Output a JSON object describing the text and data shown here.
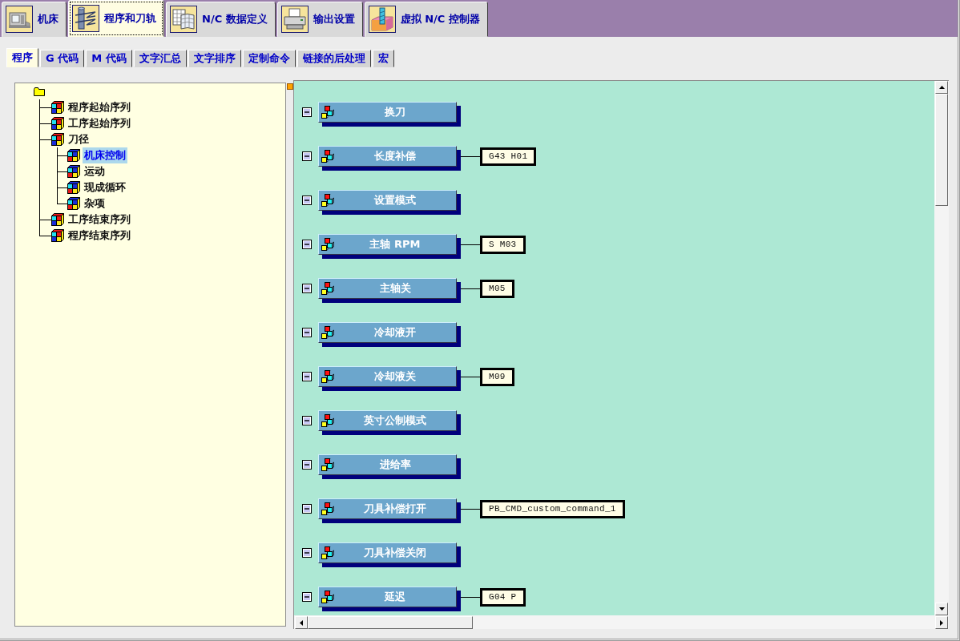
{
  "main_tabs": [
    {
      "label": "机床",
      "kind": "machine",
      "selected": false
    },
    {
      "label": "程序和刀轨",
      "kind": "program",
      "selected": true
    },
    {
      "label": "N/C 数据定义",
      "kind": "data",
      "selected": false
    },
    {
      "label": "输出设置",
      "kind": "output",
      "selected": false
    },
    {
      "label": "虚拟 N/C 控制器",
      "kind": "virtual",
      "selected": false
    }
  ],
  "sub_tabs": [
    {
      "label": "程序",
      "selected": true
    },
    {
      "label": "G 代码",
      "selected": false
    },
    {
      "label": "M 代码",
      "selected": false
    },
    {
      "label": "文字汇总",
      "selected": false
    },
    {
      "label": "文字排序",
      "selected": false
    },
    {
      "label": "定制命令",
      "selected": false
    },
    {
      "label": "链接的后处理",
      "selected": false
    },
    {
      "label": "宏",
      "selected": false
    }
  ],
  "tree": {
    "children": [
      {
        "label": "程序起始序列",
        "selected": false
      },
      {
        "label": "工序起始序列",
        "selected": false
      },
      {
        "label": "刀径",
        "selected": false,
        "children": [
          {
            "label": "机床控制",
            "selected": true
          },
          {
            "label": "运动",
            "selected": false
          },
          {
            "label": "现成循环",
            "selected": false
          },
          {
            "label": "杂项",
            "selected": false
          }
        ]
      },
      {
        "label": "工序结束序列",
        "selected": false
      },
      {
        "label": "程序结束序列",
        "selected": false
      }
    ]
  },
  "blocks": [
    {
      "label": "换刀",
      "expanded": true
    },
    {
      "label": "长度补偿",
      "expanded": true,
      "code": "G43 H01"
    },
    {
      "label": "设置模式",
      "expanded": true
    },
    {
      "label": "主轴 RPM",
      "expanded": true,
      "code": "S M03"
    },
    {
      "label": "主轴关",
      "expanded": true,
      "code": "M05"
    },
    {
      "label": "冷却液开",
      "expanded": true
    },
    {
      "label": "冷却液关",
      "expanded": true,
      "code": "M09"
    },
    {
      "label": "英寸公制模式",
      "expanded": true
    },
    {
      "label": "进给率",
      "expanded": true
    },
    {
      "label": "刀具补偿打开",
      "expanded": true,
      "code": "PB_CMD_custom_command_1"
    },
    {
      "label": "刀具补偿关闭",
      "expanded": true
    },
    {
      "label": "延迟",
      "expanded": true,
      "code": "G04 P"
    }
  ]
}
